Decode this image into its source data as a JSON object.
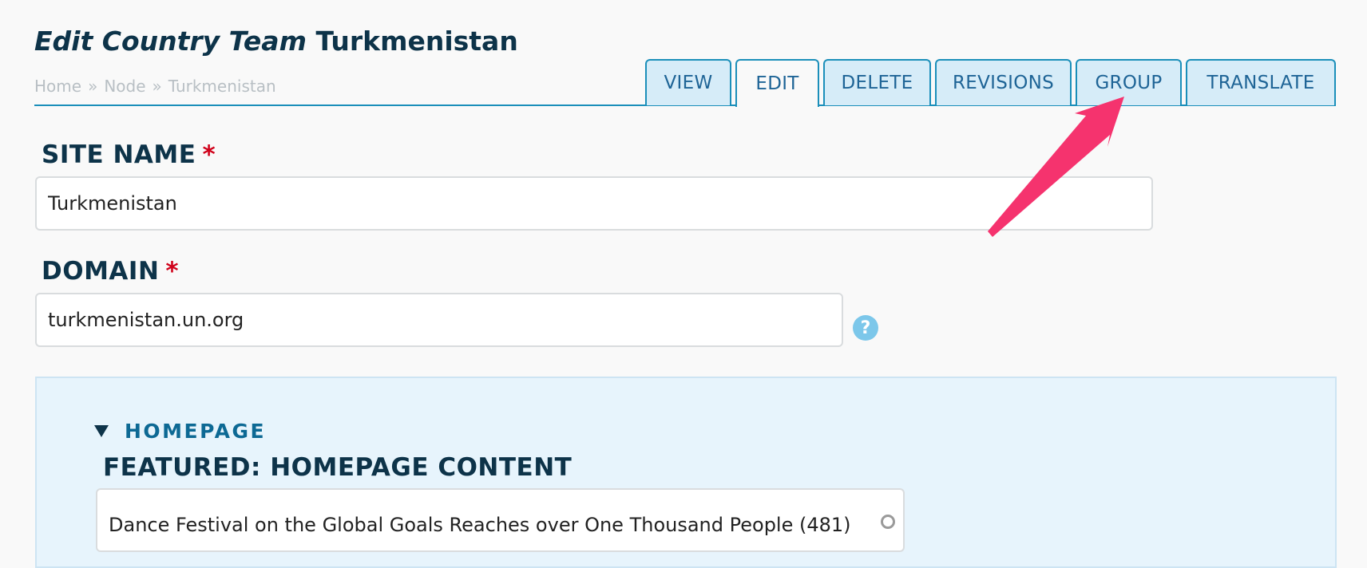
{
  "page": {
    "title_prefix": "Edit Country Team",
    "title_name": "Turkmenistan"
  },
  "breadcrumb": {
    "items": [
      "Home",
      "Node",
      "Turkmenistan"
    ],
    "separator": "»"
  },
  "tabs": [
    {
      "label": "VIEW",
      "active": false
    },
    {
      "label": "EDIT",
      "active": true
    },
    {
      "label": "DELETE",
      "active": false
    },
    {
      "label": "REVISIONS",
      "active": false
    },
    {
      "label": "GROUP",
      "active": false
    },
    {
      "label": "TRANSLATE",
      "active": false
    }
  ],
  "form": {
    "site_name": {
      "label": "SITE NAME",
      "required_mark": "*",
      "value": "Turkmenistan"
    },
    "domain": {
      "label": "DOMAIN",
      "required_mark": "*",
      "value": "turkmenistan.un.org",
      "help_glyph": "?"
    }
  },
  "homepage_fieldset": {
    "legend": "HOMEPAGE",
    "expanded": true,
    "featured": {
      "label": "FEATURED: HOMEPAGE CONTENT",
      "value": "Dance Festival on the Global Goals Reaches over One Thousand People (481)"
    }
  },
  "annotation": {
    "icon": "arrow-pointer-icon",
    "color": "#f5336e",
    "target": "GROUP"
  },
  "colors": {
    "accent": "#1b8fba",
    "tab_background": "#d6ecf8",
    "heading": "#0d3349",
    "required": "#d0021b",
    "fieldset_background": "#e7f4fc"
  }
}
